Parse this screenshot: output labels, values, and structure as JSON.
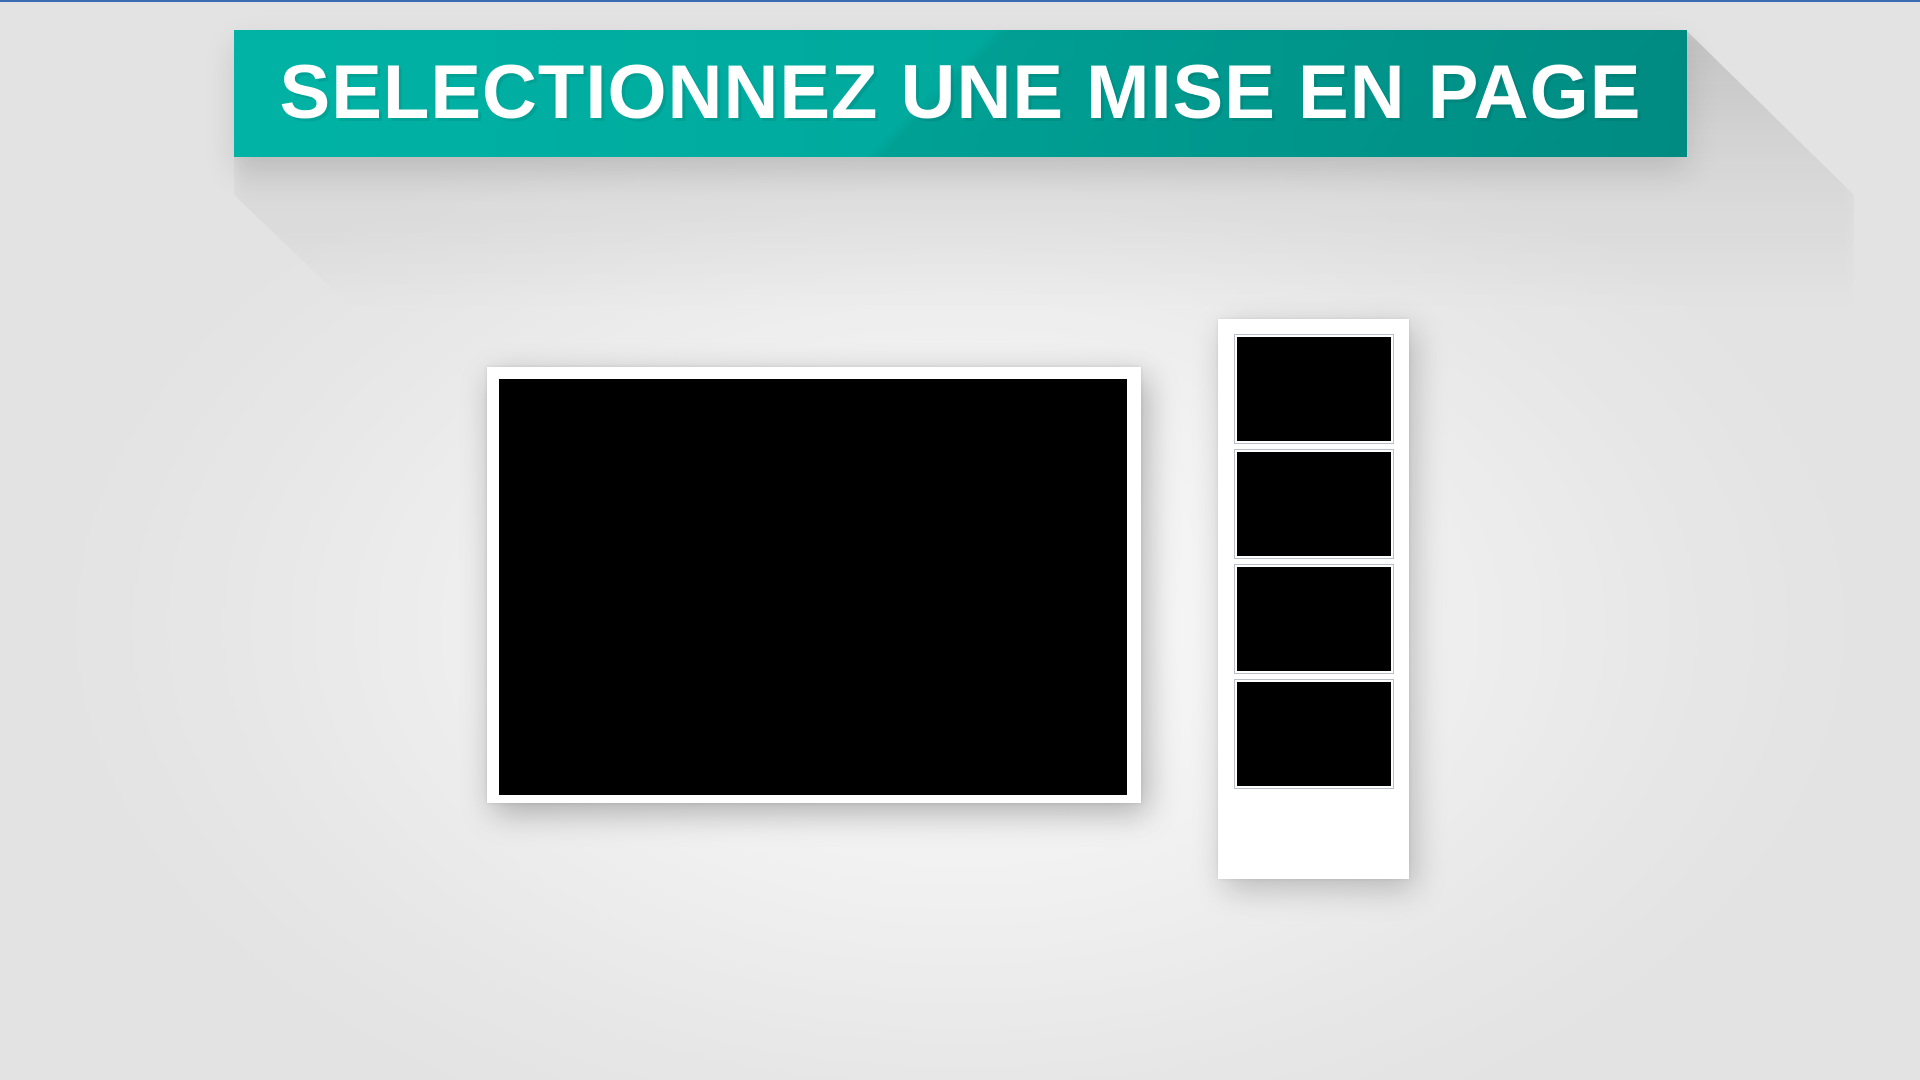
{
  "header": {
    "title": "SELECTIONNEZ UNE MISE EN PAGE"
  },
  "colors": {
    "banner": "#00aa9e",
    "photo_slot": "#000000",
    "frame": "#ffffff",
    "background": "#ebebeb"
  },
  "layouts": [
    {
      "id": "single-photo",
      "photo_slots": 1
    },
    {
      "id": "photo-strip",
      "photo_slots": 4
    }
  ]
}
